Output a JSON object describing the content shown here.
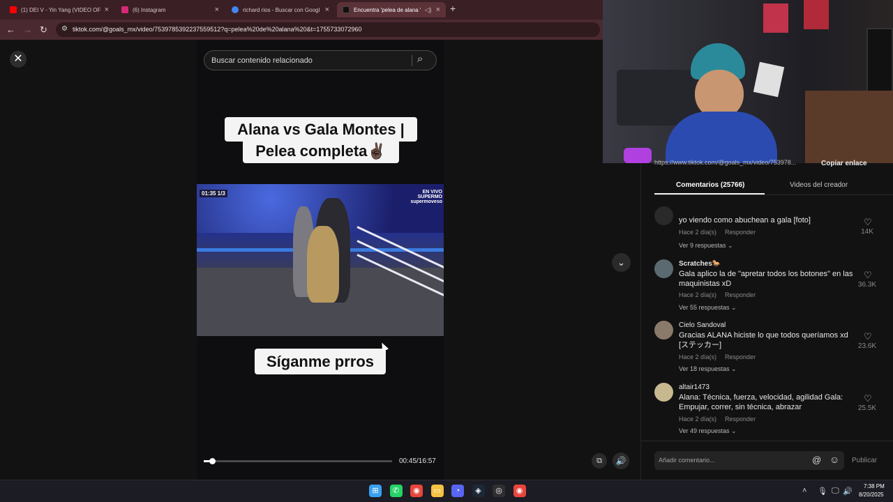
{
  "browser": {
    "tabs": [
      {
        "title": "(1) DEI V - Yin Yang (VIDEO OFI",
        "favicon_color": "#ff0000",
        "active": false
      },
      {
        "title": "(6) Instagram",
        "favicon_color": "#d62976",
        "active": false
      },
      {
        "title": "richard rios - Buscar con Googl",
        "favicon_color": "#4285f4",
        "active": false
      },
      {
        "title": "Encuentra 'pelea de alana '",
        "favicon_color": "#111111",
        "active": true
      }
    ],
    "new_tab_icon": "+",
    "url": "tiktok.com/@goals_mx/video/7539785392237559512?q=pelea%20de%20alana%20&t=1755733072960"
  },
  "video": {
    "close_icon": "✕",
    "search_placeholder": "Buscar contenido relacionado",
    "caption_line1": "Alana vs Gala Montes |",
    "caption_line2": "Pelea completa✌🏿",
    "caption_bottom": "Síganme prros",
    "clip_scoreboard": "01:35  1/3",
    "clip_brand": "EN VIVO\nSUPERMO\nsupermoveso",
    "progress": 0.046,
    "time": "00:45/16:57"
  },
  "panel": {
    "share_url": "https://www.tiktok.com/@goals_mx/video/753978...",
    "copy_link": "Copiar enlace",
    "tabs": {
      "comments": "Comentarios (25766)",
      "videos": "Videos del creador"
    },
    "comments": [
      {
        "user": "",
        "avatar_color": "#2a2a2a",
        "text": "yo viendo como abuchean a gala [foto]",
        "date": "Hace 2 día(s)",
        "reply": "Responder",
        "more": "Ver 9 respuestas ⌄",
        "likes": "14K"
      },
      {
        "user": "Scratches🐎",
        "avatar_color": "#5a6a70",
        "text": "Gala aplico la de \"apretar todos los botones\" en las maquinistas xD",
        "date": "Hace 2 día(s)",
        "reply": "Responder",
        "more": "Ver 55 respuestas ⌄",
        "likes": "36.3K"
      },
      {
        "user": "Cielo Sandoval",
        "avatar_color": "#8a7a6a",
        "text": "Gracias ALANA hiciste lo que todos queríamos xd [ステッカー]",
        "date": "Hace 2 día(s)",
        "reply": "Responder",
        "more": "Ver 18 respuestas ⌄",
        "likes": "23.6K"
      },
      {
        "user": "altair1473",
        "avatar_color": "#c8b890",
        "text": "Alana: Técnica, fuerza, velocidad, agilidad Gala: Empujar, correr, sin técnica, abrazar",
        "date": "Hace 2 día(s)",
        "reply": "Responder",
        "more": "Ver 49 respuestas ⌄",
        "likes": "25.5K"
      }
    ],
    "comment_placeholder": "Añadir comentario...",
    "publish": "Publicar"
  },
  "taskbar": {
    "apps": [
      {
        "name": "windows-start-icon",
        "color": "#3aa0f0",
        "glyph": "⊞"
      },
      {
        "name": "whatsapp-icon",
        "color": "#25d366",
        "glyph": "✆"
      },
      {
        "name": "chrome-icon",
        "color": "#e8453c",
        "glyph": "◉"
      },
      {
        "name": "file-explorer-icon",
        "color": "#f5c242",
        "glyph": "▭"
      },
      {
        "name": "discord-icon",
        "color": "#5865f2",
        "glyph": "◔"
      },
      {
        "name": "steam-icon",
        "color": "#1b2838",
        "glyph": "◈"
      },
      {
        "name": "obs-icon",
        "color": "#302e31",
        "glyph": "◎"
      },
      {
        "name": "chrome-icon-2",
        "color": "#e8453c",
        "glyph": "◉"
      }
    ],
    "time": "7:38 PM",
    "date": "8/20/2025"
  }
}
